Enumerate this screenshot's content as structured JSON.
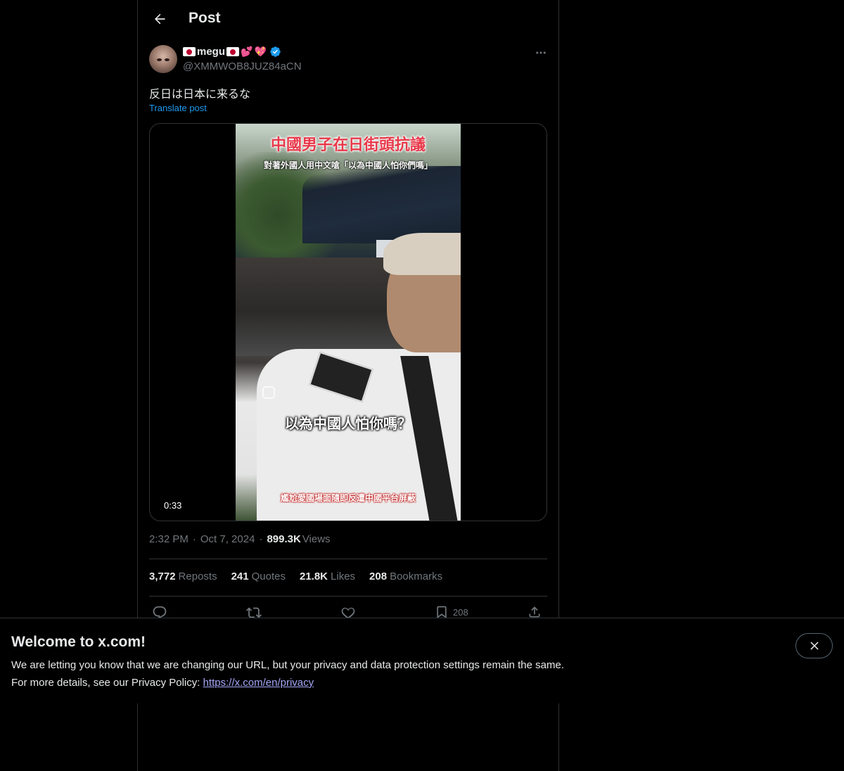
{
  "header": {
    "title": "Post",
    "back_icon": "arrow-left-icon"
  },
  "post": {
    "author": {
      "name": "megu",
      "name_decorations": [
        "japan-flag-emoji",
        "japan-flag-emoji",
        "two-hearts-emoji",
        "heart-emoji"
      ],
      "verified_icon": "verified-badge-icon",
      "handle": "@XMMWOB8JUZ84aCN"
    },
    "text": "反日は日本に来るな",
    "translate_label": "Translate post",
    "media": {
      "overlay_title": "中國男子在日街頭抗議",
      "overlay_subtitle": "對著外國人用中文嗆「以為中國人怕你們嗎」",
      "overlay_caption": "以為中國人怕你嗎？",
      "overlay_bottom": "尷尬愛國場面隨即反遭中國平台屏蔽",
      "duration": "0:33"
    },
    "time": "2:32 PM",
    "separator": "·",
    "date": "Oct 7, 2024",
    "views_count": "899.3K",
    "views_label": "Views",
    "stats": {
      "reposts_count": "3,772",
      "reposts_label": "Reposts",
      "quotes_count": "241",
      "quotes_label": "Quotes",
      "likes_count": "21.8K",
      "likes_label": "Likes",
      "bookmarks_count": "208",
      "bookmarks_label": "Bookmarks"
    },
    "actions": {
      "reply_icon": "reply-icon",
      "repost_icon": "repost-icon",
      "like_icon": "heart-icon",
      "bookmark_icon": "bookmark-icon",
      "bookmark_count": "208",
      "share_icon": "share-icon"
    }
  },
  "cookie_banner": {
    "title": "Welcome to x.com!",
    "line1": "We are letting you know that we are changing our URL, but your privacy and data protection settings remain the same.",
    "line2_prefix": "For more details, see our Privacy Policy: ",
    "link_text": "https://x.com/en/privacy",
    "close_icon": "close-icon"
  },
  "colors": {
    "background": "#000000",
    "text_primary": "#e7e9ea",
    "text_secondary": "#71767b",
    "accent": "#1d9bf0",
    "border": "#2f3336",
    "link": "#a4a6f6"
  }
}
